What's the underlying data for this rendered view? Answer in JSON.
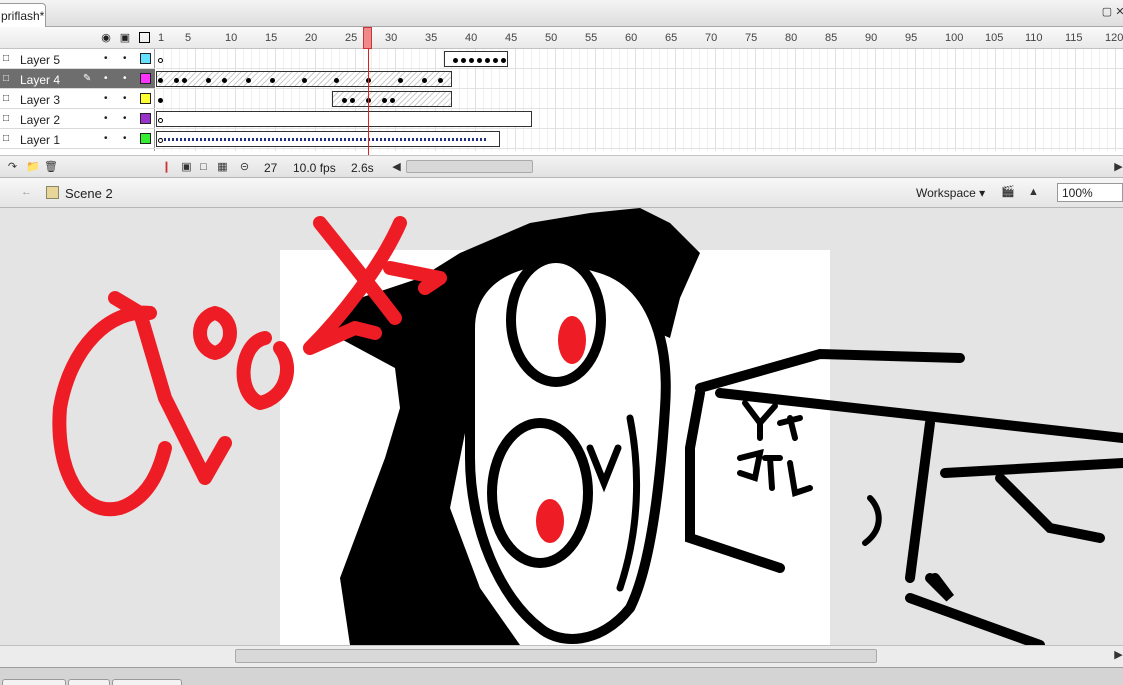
{
  "document": {
    "tab_title": "priflash*"
  },
  "window_controls": {
    "minimize": "minimize-icon",
    "close": "close-icon"
  },
  "timeline": {
    "ruler_labels": [
      "1",
      "5",
      "10",
      "15",
      "20",
      "25",
      "30",
      "35",
      "40",
      "45",
      "50",
      "55",
      "60",
      "65",
      "70",
      "75",
      "80",
      "85",
      "90",
      "95",
      "100",
      "105",
      "110",
      "115",
      "120"
    ],
    "current_frame": 27,
    "layers": [
      {
        "name": "Layer 5",
        "color": "#66e0ff",
        "selected": false
      },
      {
        "name": "Layer 4",
        "color": "#ff33ff",
        "selected": true
      },
      {
        "name": "Layer 3",
        "color": "#ffff33",
        "selected": false
      },
      {
        "name": "Layer 2",
        "color": "#9933cc",
        "selected": false
      },
      {
        "name": "Layer 1",
        "color": "#33ee33",
        "selected": false
      }
    ],
    "status": {
      "frame": "27",
      "fps": "10.0 fps",
      "time": "2.6s"
    }
  },
  "editbar": {
    "scene": "Scene 2",
    "workspace": "Workspace",
    "zoom": "100%"
  },
  "stage": {
    "background": "#ffffff",
    "accent": "#ee1c24"
  }
}
